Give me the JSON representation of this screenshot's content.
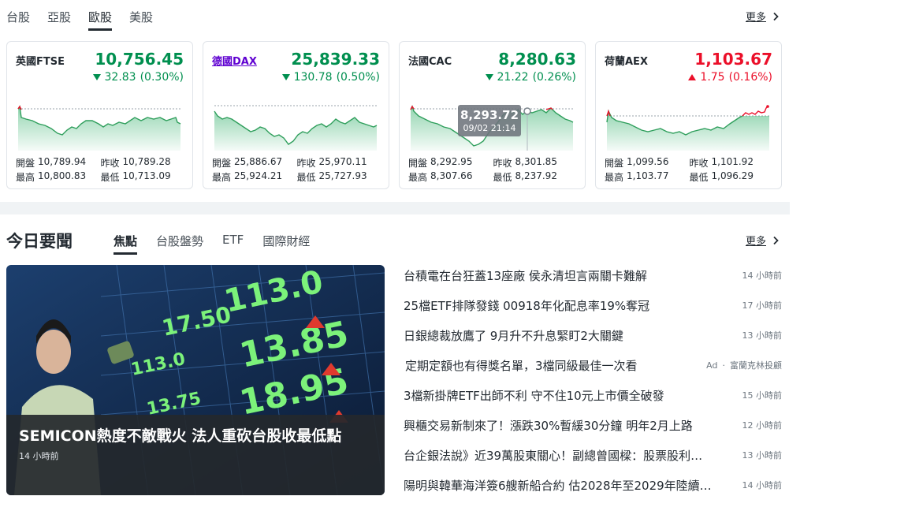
{
  "market_tabs": [
    "台股",
    "亞股",
    "歐股",
    "美股"
  ],
  "active_market_tab": 2,
  "more_label": "更多",
  "cards": [
    {
      "name": "英國FTSE",
      "price": "10,756.45",
      "change": "32.83",
      "pct": "(0.30%)",
      "direction": "down",
      "open_label": "開盤",
      "open": "10,789.94",
      "prev_label": "昨收",
      "prev": "10,789.28",
      "high_label": "最高",
      "high": "10,800.83",
      "low_label": "最低",
      "low": "10,713.09"
    },
    {
      "name": "德國DAX",
      "price": "25,839.33",
      "change": "130.78",
      "pct": "(0.50%)",
      "direction": "down",
      "open_label": "開盤",
      "open": "25,886.67",
      "prev_label": "昨收",
      "prev": "25,970.11",
      "high_label": "最高",
      "high": "25,924.21",
      "low_label": "最低",
      "low": "25,727.93"
    },
    {
      "name": "法國CAC",
      "price": "8,280.63",
      "change": "21.22",
      "pct": "(0.26%)",
      "direction": "down",
      "open_label": "開盤",
      "open": "8,292.95",
      "prev_label": "昨收",
      "prev": "8,301.85",
      "high_label": "最高",
      "high": "8,307.66",
      "low_label": "最低",
      "low": "8,237.92",
      "tooltip": {
        "value": "8,293.72",
        "time": "09/02 21:14"
      }
    },
    {
      "name": "荷蘭AEX",
      "price": "1,103.67",
      "change": "1.75",
      "pct": "(0.16%)",
      "direction": "up",
      "open_label": "開盤",
      "open": "1,099.56",
      "prev_label": "昨收",
      "prev": "1,101.92",
      "high_label": "最高",
      "high": "1,103.77",
      "low_label": "最低",
      "low": "1,096.29"
    }
  ],
  "news": {
    "title": "今日要聞",
    "tabs": [
      "焦點",
      "台股盤勢",
      "ETF",
      "國際財經"
    ],
    "active_tab": 0,
    "more_label": "更多",
    "hero": {
      "headline": "SEMICON熱度不敵戰火 法人重砍台股收最低點",
      "time": "14 小時前"
    },
    "items": [
      {
        "title": "台積電在台狂蓋13座廠 侯永清坦言兩關卡難解",
        "time": "14 小時前"
      },
      {
        "title": "25檔ETF排隊發錢 00918年化配息率19%奪冠",
        "time": "17 小時前"
      },
      {
        "title": "日銀總裁放鷹了 9月升不升息緊盯2大關鍵",
        "time": "13 小時前"
      },
      {
        "title": "定期定額也有得獎名單，3檔同級最佳一次看",
        "ad_label": "Ad",
        "sponsor": "富蘭克林投顧"
      },
      {
        "title": "3檔新掛牌ETF出師不利 守不住10元上市價全破發",
        "time": "15 小時前"
      },
      {
        "title": "興櫃交易新制來了！漲跌30%暫緩30分鐘 明年2月上路",
        "time": "12 小時前"
      },
      {
        "title": "台企銀法說》近39萬股東關心！副總曾國樑：股票股利…",
        "time": "13 小時前"
      },
      {
        "title": "陽明與韓華海洋簽6艘新船合約 估2028年至2029年陸續…",
        "time": "14 小時前"
      }
    ]
  },
  "colors": {
    "up": "#eb0f29",
    "down": "#008f4f",
    "link": "#5f01d1"
  }
}
